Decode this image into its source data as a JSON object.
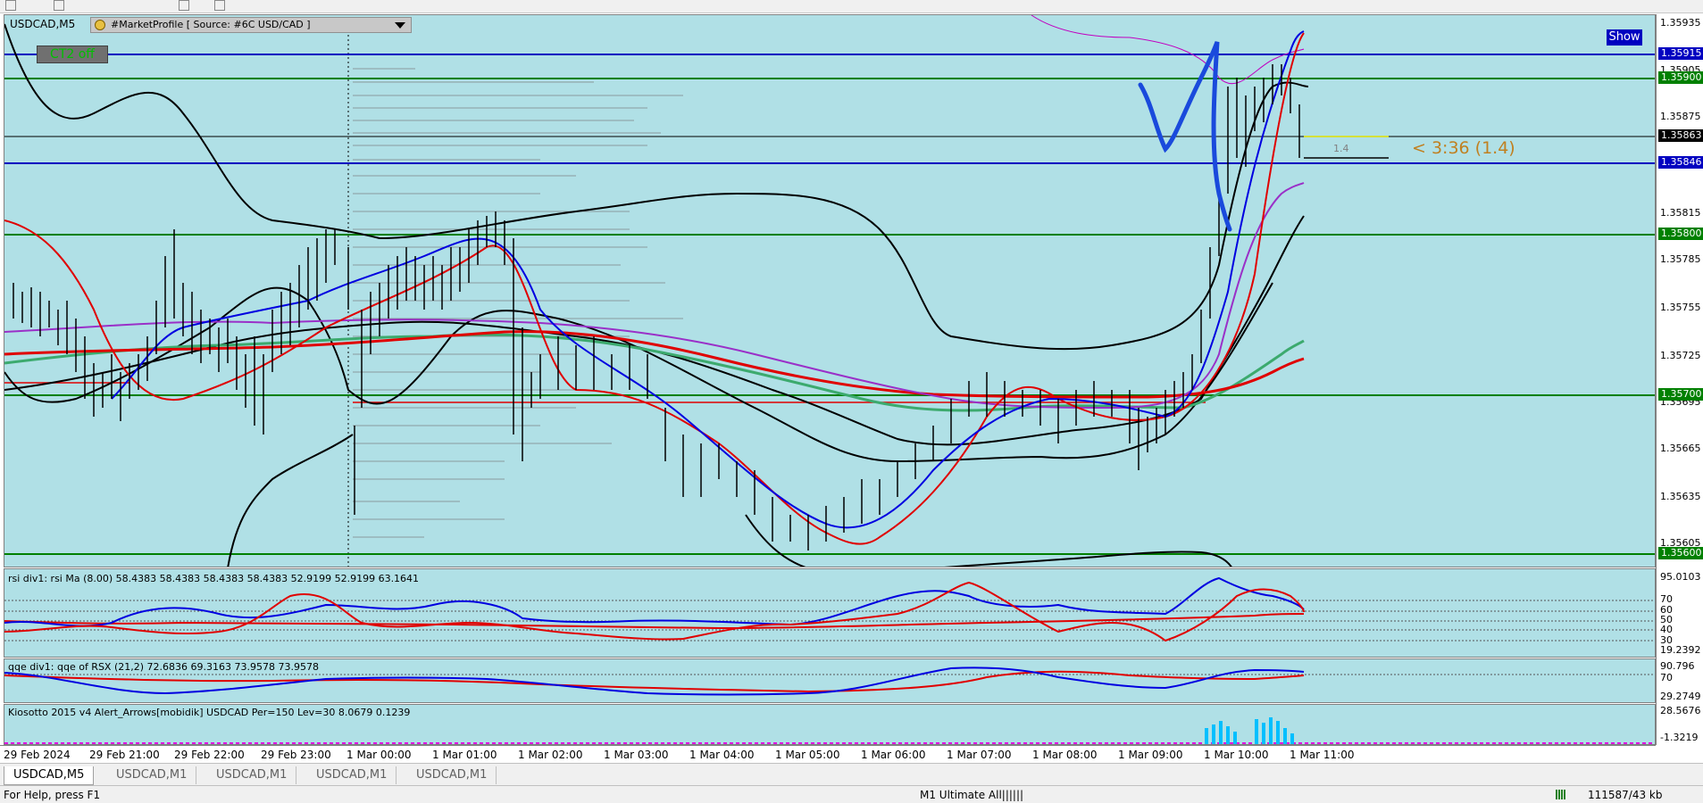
{
  "chart": {
    "symbol_title": "USDCAD,M5",
    "market_profile_label": "#MarketProfile [ Source: #6C USD/CAD ]",
    "ct_button": "CT2 off",
    "show_button": "Show",
    "timer_label": "< 3:36 (1.4)",
    "spread_label": "1.4",
    "price_labels": [
      "1.35935",
      "1.35905",
      "1.35875",
      "1.35815",
      "1.35785",
      "1.35755",
      "1.35725",
      "1.35695",
      "1.35665",
      "1.35635",
      "1.35605"
    ],
    "level_tags": [
      "1.35915",
      "1.35900",
      "1.35863",
      "1.35846",
      "1.35800",
      "1.35700",
      "1.35600"
    ],
    "time_labels": [
      "29 Feb 2024",
      "29 Feb 21:00",
      "29 Feb 22:00",
      "29 Feb 23:00",
      "1 Mar 00:00",
      "1 Mar 01:00",
      "1 Mar 02:00",
      "1 Mar 03:00",
      "1 Mar 04:00",
      "1 Mar 05:00",
      "1 Mar 06:00",
      "1 Mar 07:00",
      "1 Mar 08:00",
      "1 Mar 09:00",
      "1 Mar 10:00",
      "1 Mar 11:00"
    ]
  },
  "rsi_pane": {
    "label": "rsi div1: rsi Ma (8.00) 58.4383 58.4383 58.4383 58.4383 52.9199 52.9199 63.1641",
    "scale": [
      "95.0103",
      "70",
      "60",
      "50",
      "40",
      "30",
      "19.2392"
    ]
  },
  "qqe_pane": {
    "label": "qqe div1: qqe of RSX (21,2) 72.6836 69.3163 73.9578 73.9578",
    "scale": [
      "90.796",
      "70",
      "29.2749"
    ]
  },
  "kiosotto_pane": {
    "label": "Kiosotto 2015 v4 Alert_Arrows[mobidik] USDCAD Per=150 Lev=30 8.0679 0.1239",
    "scale": [
      "28.5676",
      "-1.3219"
    ]
  },
  "tabs": [
    "USDCAD,M5",
    "USDCAD,M1",
    "USDCAD,M1",
    "USDCAD,M1",
    "USDCAD,M1"
  ],
  "status": {
    "help": "For Help, press F1",
    "profile": "M1 Ultimate All||||||",
    "traffic": "111587/43 kb"
  },
  "colors": {
    "chart_bg": "#b0e0e6",
    "blue_level": "#0000c0",
    "green_level": "#008000",
    "candle": "#000000"
  }
}
